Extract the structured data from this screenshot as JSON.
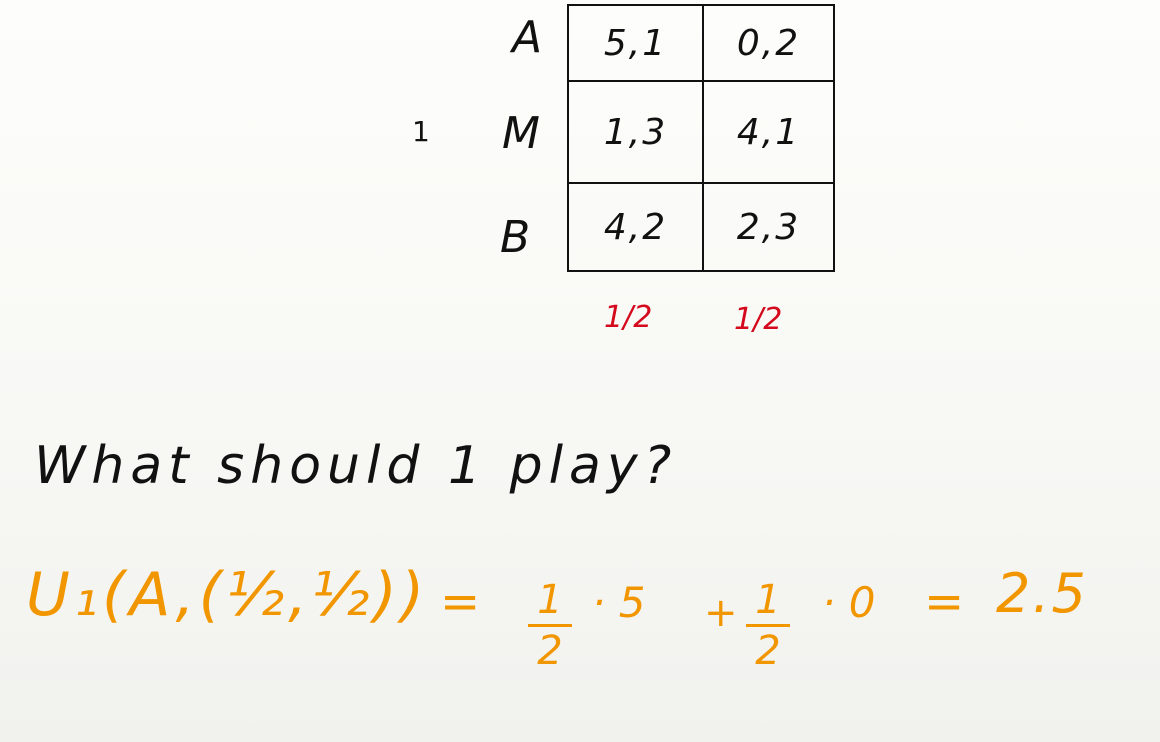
{
  "game": {
    "player1_label": "1",
    "rows": [
      {
        "label": "A",
        "cells": [
          "5,1",
          "0,2"
        ]
      },
      {
        "label": "M",
        "cells": [
          "1,3",
          "4,1"
        ]
      },
      {
        "label": "B",
        "cells": [
          "4,2",
          "2,3"
        ]
      }
    ],
    "column_probabilities": [
      "1/2",
      "1/2"
    ]
  },
  "question": "What should 1 play?",
  "equation": {
    "lhs": "U₁(A,(½,½))",
    "equals": "=",
    "term1_num": "1",
    "term1_den": "2",
    "term1_mult": "· 5",
    "plus": "+",
    "term2_num": "1",
    "term2_den": "2",
    "term2_mult": "· 0",
    "equals2": "=",
    "result": "2.5"
  },
  "colors": {
    "ink": "#111111",
    "probability": "#d4091c",
    "calculation": "#f29600",
    "board": "#fbfbf8"
  }
}
